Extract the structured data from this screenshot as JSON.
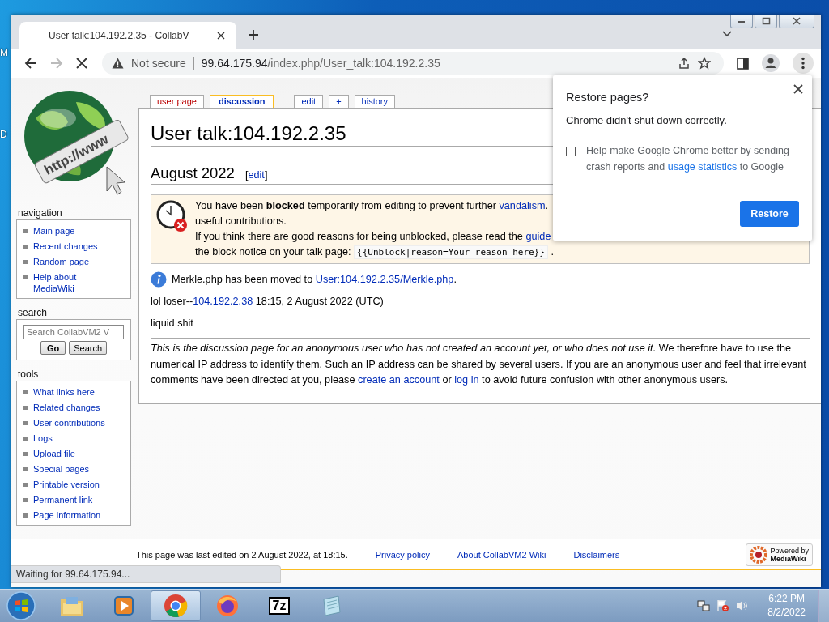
{
  "desktop": {
    "icon_labels": [
      "M",
      "D"
    ]
  },
  "browser": {
    "tabs": [
      {
        "title": "User talk:104.192.2.35 - CollabV",
        "selected": true
      }
    ],
    "loading": true,
    "forward_disabled": true,
    "address": {
      "security": "Not secure",
      "host": "99.64.175.94",
      "path": "/index.php/User_talk:104.192.2.35"
    },
    "status": "Waiting for 99.64.175.94..."
  },
  "wiki": {
    "logo": {
      "text": "http://www"
    },
    "page_tabs": [
      {
        "label": "user page",
        "selected": false,
        "missing": true
      },
      {
        "label": "discussion",
        "selected": true,
        "missing": false
      },
      {
        "label": "edit",
        "selected": false,
        "missing": false
      },
      {
        "label": "+",
        "selected": false,
        "missing": false
      },
      {
        "label": "history",
        "selected": false,
        "missing": false
      }
    ],
    "sidebar": [
      {
        "title": "navigation",
        "items": [
          "Main page",
          "Recent changes",
          "Random page",
          "Help about MediaWiki"
        ]
      },
      {
        "title": "search",
        "search": {
          "placeholder": "Search CollabVM2 V",
          "buttons": [
            "Go",
            "Search"
          ]
        }
      },
      {
        "title": "tools",
        "items": [
          "What links here",
          "Related changes",
          "User contributions",
          "Logs",
          "Upload file",
          "Special pages",
          "Printable version",
          "Permanent link",
          "Page information"
        ]
      }
    ],
    "title": "User talk:104.192.2.35",
    "section": {
      "heading": "August 2022",
      "open": "[",
      "edit": "edit",
      "close": "]"
    },
    "notice": [
      [
        {
          "kind": "text",
          "text": "You have been **blocked** temporarily from editing to prevent further "
        },
        {
          "kind": "link",
          "text": "vandalism"
        },
        {
          "kind": "text",
          "text": "."
        }
      ],
      [
        {
          "kind": "text",
          "text": "useful contributions."
        }
      ],
      [
        {
          "kind": "text",
          "text": "If you think there are good reasons for being unblocked, please read the "
        },
        {
          "kind": "link",
          "text": "guide"
        }
      ],
      [
        {
          "kind": "text",
          "text": "the block notice on your talk page: "
        },
        {
          "kind": "code",
          "text": "{{Unblock|reason=Your reason here}}"
        },
        {
          "kind": "text",
          "text": " ."
        }
      ]
    ],
    "moved": [
      {
        "kind": "text",
        "text": "Merkle.php has been moved to "
      },
      {
        "kind": "link",
        "text": "User:104.192.2.35/Merkle.php"
      },
      {
        "kind": "text",
        "text": "."
      }
    ],
    "comments": [
      [
        {
          "kind": "text",
          "text": "lol loser--"
        },
        {
          "kind": "link",
          "text": "104.192.2.38"
        },
        {
          "kind": "text",
          "text": " 18:15, 2 August 2022 (UTC)"
        }
      ],
      [
        {
          "kind": "text",
          "text": "liquid shit"
        }
      ]
    ],
    "disclaimer": [
      {
        "kind": "text",
        "text": "*This is the discussion page for an anonymous user who has not created an account yet, or who does not use it.* We therefore have to use the numerical IP address to identify them. Such an IP address can be shared by several users. If you are an anonymous user and feel that irrelevant comments have been directed at you, please "
      },
      {
        "kind": "link",
        "text": "create an account"
      },
      {
        "kind": "text",
        "text": " or "
      },
      {
        "kind": "link",
        "text": "log in"
      },
      {
        "kind": "text",
        "text": " to avoid future confusion with other anonymous users."
      }
    ],
    "footer": {
      "last_edited": "This page was last edited on 2 August 2022, at 18:15.",
      "links": [
        "Privacy policy",
        "About CollabVM2 Wiki",
        "Disclaimers"
      ],
      "badge": {
        "top": "Powered by",
        "bottom": "MediaWiki"
      }
    }
  },
  "popup": {
    "title": "Restore pages?",
    "message": "Chrome didn't shut down correctly.",
    "checkbox": {
      "checked": false,
      "label": [
        {
          "kind": "text",
          "text": "Help make Google Chrome better by sending crash reports and "
        },
        {
          "kind": "link",
          "text": "usage statistics"
        },
        {
          "kind": "text",
          "text": " to Google"
        }
      ]
    },
    "button": "Restore"
  },
  "taskbar": {
    "apps": [
      {
        "kind": "explorer",
        "selected": false
      },
      {
        "kind": "media",
        "selected": false
      },
      {
        "kind": "chrome",
        "selected": true
      },
      {
        "kind": "firefox",
        "selected": false
      },
      {
        "kind": "sevenzip",
        "selected": false,
        "label": "7z"
      },
      {
        "kind": "notepad",
        "selected": false
      }
    ],
    "clock": {
      "time": "6:22 PM",
      "date": "8/2/2022"
    }
  }
}
